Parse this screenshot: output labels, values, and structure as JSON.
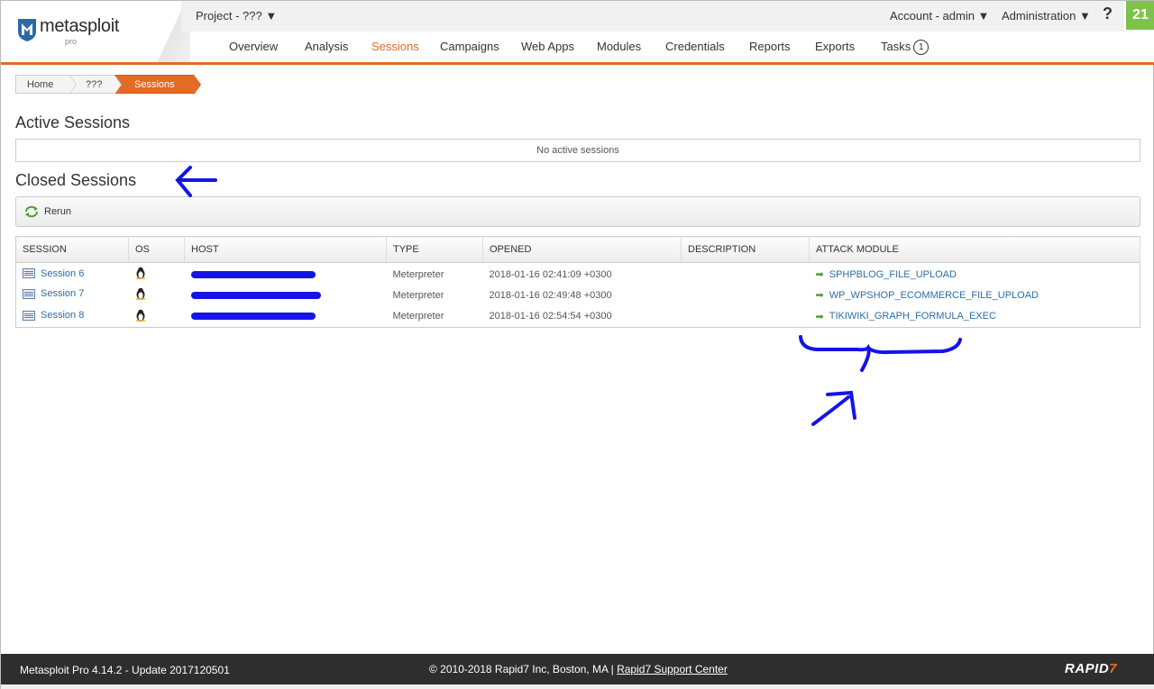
{
  "app": {
    "logo_text": "metasploit",
    "logo_edition": "pro"
  },
  "topbar": {
    "project": "Project - ??? ▼",
    "account": "Account - admin ▼",
    "administration": "Administration ▼",
    "help": "?",
    "notifications": "21"
  },
  "nav": {
    "items": [
      "Overview",
      "Analysis",
      "Sessions",
      "Campaigns",
      "Web Apps",
      "Modules",
      "Credentials",
      "Reports",
      "Exports",
      "Tasks"
    ],
    "tasks_count": "1",
    "active": "Sessions"
  },
  "breadcrumb": [
    "Home",
    "???",
    "Sessions"
  ],
  "active_sessions": {
    "title": "Active Sessions",
    "empty_text": "No active sessions"
  },
  "closed_sessions": {
    "title": "Closed Sessions",
    "rerun_label": "Rerun",
    "columns": [
      "SESSION",
      "OS",
      "HOST",
      "TYPE",
      "OPENED",
      "DESCRIPTION",
      "ATTACK MODULE"
    ],
    "rows": [
      {
        "session": "Session 6",
        "os": "linux-icon",
        "type": "Meterpreter",
        "opened": "2018-01-16 02:41:09 +0300",
        "description": "",
        "module": "SPHPBLOG_FILE_UPLOAD"
      },
      {
        "session": "Session 7",
        "os": "linux-icon",
        "type": "Meterpreter",
        "opened": "2018-01-16 02:49:48 +0300",
        "description": "",
        "module": "WP_WPSHOP_ECOMMERCE_FILE_UPLOAD"
      },
      {
        "session": "Session 8",
        "os": "linux-icon",
        "type": "Meterpreter",
        "opened": "2018-01-16 02:54:54 +0300",
        "description": "",
        "module": "TIKIWIKI_GRAPH_FORMULA_EXEC"
      }
    ]
  },
  "footer": {
    "version": "Metasploit Pro 4.14.2 - Update 2017120501",
    "copyright": "© 2010-2018 Rapid7 Inc, Boston, MA |",
    "support_link": "Rapid7 Support Center",
    "brand": "RAPID",
    "brand_mark": "7"
  },
  "colors": {
    "accent": "#e46b26",
    "link": "#2a6ea6",
    "annotation": "#1414e6",
    "badge": "#7dc24b"
  }
}
